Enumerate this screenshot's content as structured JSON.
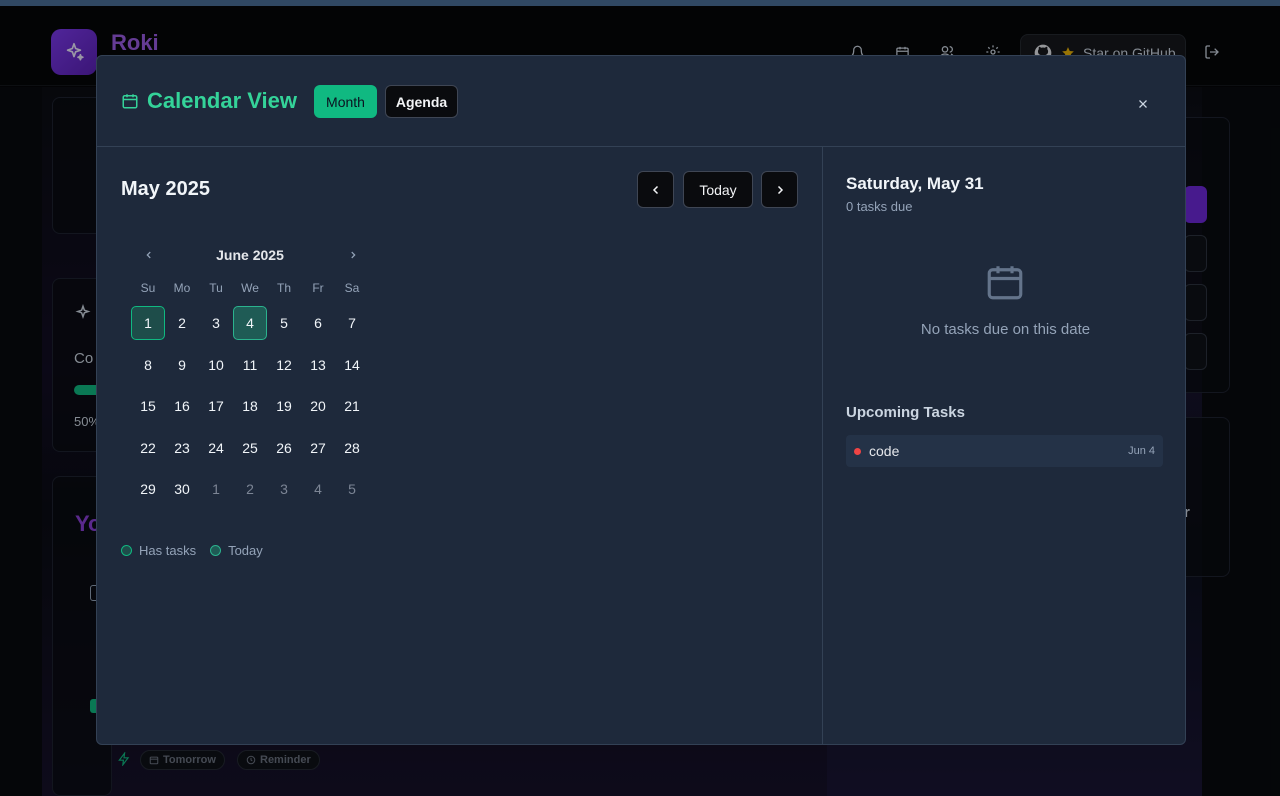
{
  "app": {
    "name": "Roki",
    "github_label": "Star on GitHub"
  },
  "background": {
    "card_text_1": "Co",
    "card_text_2": "50%",
    "purple_text": "Yo",
    "right_text": "r",
    "pill_tomorrow": "Tomorrow",
    "pill_reminder": "Reminder"
  },
  "modal": {
    "title": "Calendar View",
    "view_tabs": {
      "month": "Month",
      "agenda": "Agenda"
    },
    "current_month": "May 2025",
    "today_button": "Today",
    "mini_calendar": {
      "caption": "June 2025",
      "weekdays": [
        "Su",
        "Mo",
        "Tu",
        "We",
        "Th",
        "Fr",
        "Sa"
      ],
      "weeks": [
        [
          {
            "d": "1",
            "state": "has-task"
          },
          {
            "d": "2"
          },
          {
            "d": "3"
          },
          {
            "d": "4",
            "state": "today"
          },
          {
            "d": "5"
          },
          {
            "d": "6"
          },
          {
            "d": "7"
          }
        ],
        [
          {
            "d": "8"
          },
          {
            "d": "9"
          },
          {
            "d": "10"
          },
          {
            "d": "11"
          },
          {
            "d": "12"
          },
          {
            "d": "13"
          },
          {
            "d": "14"
          }
        ],
        [
          {
            "d": "15"
          },
          {
            "d": "16"
          },
          {
            "d": "17"
          },
          {
            "d": "18"
          },
          {
            "d": "19"
          },
          {
            "d": "20"
          },
          {
            "d": "21"
          }
        ],
        [
          {
            "d": "22"
          },
          {
            "d": "23"
          },
          {
            "d": "24"
          },
          {
            "d": "25"
          },
          {
            "d": "26"
          },
          {
            "d": "27"
          },
          {
            "d": "28"
          }
        ],
        [
          {
            "d": "29"
          },
          {
            "d": "30"
          },
          {
            "d": "1",
            "outside": true
          },
          {
            "d": "2",
            "outside": true
          },
          {
            "d": "3",
            "outside": true
          },
          {
            "d": "4",
            "outside": true
          },
          {
            "d": "5",
            "outside": true
          }
        ]
      ]
    },
    "legend": {
      "has_tasks": "Has tasks",
      "today": "Today",
      "has_tasks_color": "#1e4d4a",
      "today_color": "#1f5b55"
    },
    "selected_date": {
      "label": "Saturday, May 31",
      "count": "0 tasks due",
      "empty_message": "No tasks due on this date"
    },
    "upcoming": {
      "title": "Upcoming Tasks",
      "tasks": [
        {
          "name": "code",
          "date": "Jun 4",
          "priority_color": "#ef4444"
        }
      ]
    }
  },
  "colors": {
    "accent": "#10b981",
    "title": "#34d399",
    "modal_bg": "#1e293b"
  }
}
